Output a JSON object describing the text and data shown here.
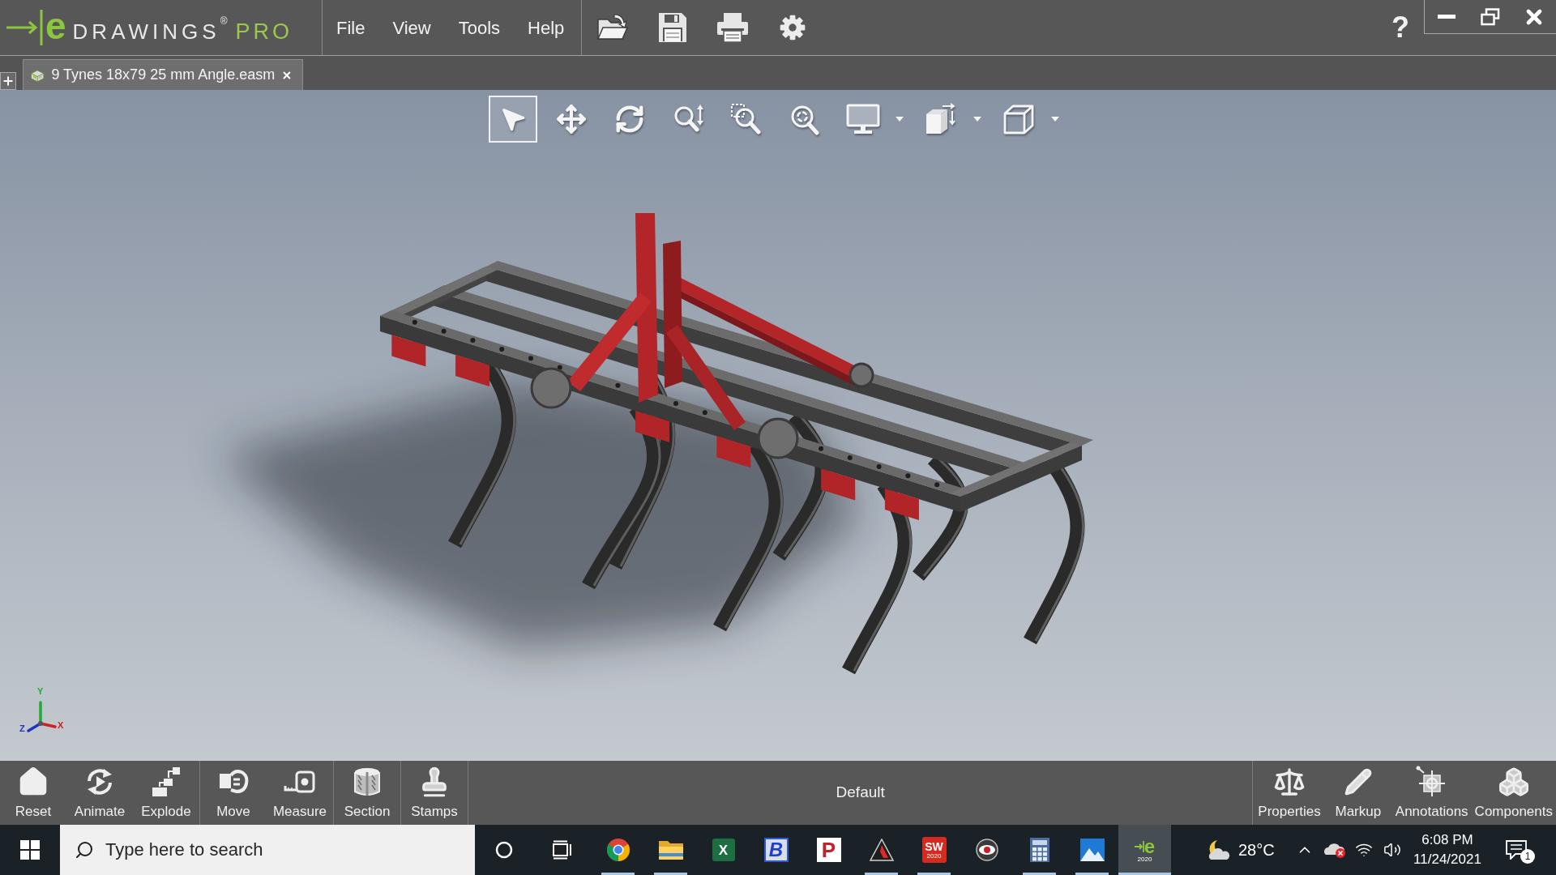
{
  "title_bar": {
    "logo": {
      "letter": "e",
      "word": "DRAWINGS",
      "mark": "®",
      "edition": "PRO"
    },
    "menu": [
      {
        "label": "File"
      },
      {
        "label": "View"
      },
      {
        "label": "Tools"
      },
      {
        "label": "Help"
      }
    ],
    "help": "?"
  },
  "tabs": [
    {
      "label": "9 Tynes 18x79 25 mm Angle.easm",
      "selected": true
    }
  ],
  "view_toolbar": [
    {
      "kind": "select",
      "selected": true,
      "dropdown": false
    },
    {
      "kind": "pan",
      "selected": false,
      "dropdown": false
    },
    {
      "kind": "rotate",
      "selected": false,
      "dropdown": false
    },
    {
      "kind": "zoom_fit",
      "selected": false,
      "dropdown": false
    },
    {
      "kind": "zoom_area",
      "selected": false,
      "dropdown": false
    },
    {
      "kind": "zoom",
      "selected": false,
      "dropdown": false
    },
    {
      "kind": "display",
      "selected": false,
      "dropdown": true
    },
    {
      "kind": "orientation",
      "selected": false,
      "dropdown": true
    },
    {
      "kind": "view",
      "selected": false,
      "dropdown": true
    }
  ],
  "triad": [
    {
      "kind": "y",
      "label": "Y",
      "color": "#22aa33"
    },
    {
      "kind": "x",
      "label": "X",
      "color": "#cc2222"
    },
    {
      "kind": "z",
      "label": "Z",
      "color": "#2233bb"
    }
  ],
  "bottom_toolbar": {
    "groups": [
      [
        {
          "kind": "reset",
          "label": "Reset"
        },
        {
          "kind": "animate",
          "label": "Animate"
        },
        {
          "kind": "explode",
          "label": "Explode"
        }
      ],
      [
        {
          "kind": "move",
          "label": "Move"
        },
        {
          "kind": "measure",
          "label": "Measure"
        }
      ],
      [
        {
          "kind": "section",
          "label": "Section"
        }
      ],
      [
        {
          "kind": "stamps",
          "label": "Stamps"
        }
      ]
    ],
    "configuration": "Default",
    "panels": [
      {
        "kind": "properties",
        "label": "Properties"
      },
      {
        "kind": "markup",
        "label": "Markup"
      },
      {
        "kind": "annotations",
        "label": "Annotations"
      },
      {
        "kind": "components",
        "label": "Components"
      }
    ]
  },
  "taskbar": {
    "search": {
      "placeholder": "Type here to search"
    },
    "apps": [
      {
        "kind": "cortana",
        "running": false,
        "active": false
      },
      {
        "kind": "task_view",
        "running": false,
        "active": false
      },
      {
        "kind": "chrome",
        "running": true,
        "active": false
      },
      {
        "kind": "explorer",
        "running": true,
        "active": false
      },
      {
        "kind": "excel",
        "glyph": "X",
        "running": false,
        "active": false
      },
      {
        "kind": "letter_b",
        "glyph": "B",
        "running": false,
        "active": false
      },
      {
        "kind": "letter_p",
        "glyph": "P",
        "running": false,
        "active": false
      },
      {
        "kind": "autodesk",
        "running": true,
        "active": false
      },
      {
        "kind": "solidworks",
        "glyph": "SW",
        "caption": "2020",
        "running": true,
        "active": false
      },
      {
        "kind": "eye",
        "running": false,
        "active": false
      },
      {
        "kind": "calculator",
        "running": true,
        "active": false
      },
      {
        "kind": "photos",
        "running": true,
        "active": false
      },
      {
        "kind": "edrawings",
        "glyph": "e",
        "caption": "2020",
        "running": true,
        "active": true
      }
    ],
    "weather": {
      "temperature": "28°C"
    },
    "clock": {
      "time": "6:08 PM",
      "date": "11/24/2021"
    },
    "notifications": "1"
  }
}
